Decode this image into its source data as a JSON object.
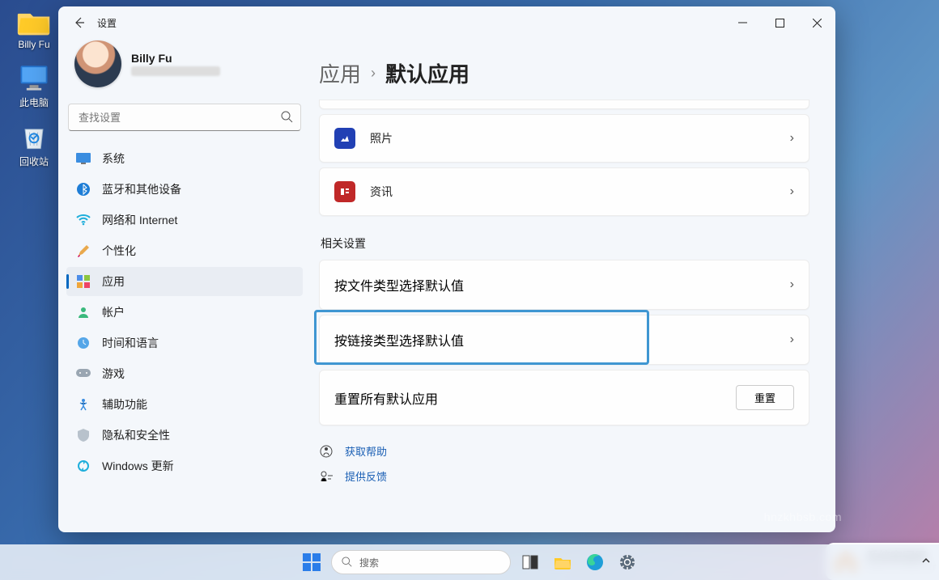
{
  "desktop": {
    "icons": [
      {
        "name": "billy-fu-folder",
        "label": "Billy Fu"
      },
      {
        "name": "this-pc",
        "label": "此电脑"
      },
      {
        "name": "recycle-bin",
        "label": "回收站"
      }
    ]
  },
  "settings_window": {
    "title": "设置",
    "profile": {
      "name": "Billy Fu"
    },
    "search": {
      "placeholder": "查找设置"
    },
    "nav": [
      {
        "id": "system",
        "label": "系统"
      },
      {
        "id": "bluetooth",
        "label": "蓝牙和其他设备"
      },
      {
        "id": "network",
        "label": "网络和 Internet"
      },
      {
        "id": "personalization",
        "label": "个性化"
      },
      {
        "id": "apps",
        "label": "应用",
        "active": true
      },
      {
        "id": "accounts",
        "label": "帐户"
      },
      {
        "id": "time",
        "label": "时间和语言"
      },
      {
        "id": "gaming",
        "label": "游戏"
      },
      {
        "id": "accessibility",
        "label": "辅助功能"
      },
      {
        "id": "privacy",
        "label": "隐私和安全性"
      },
      {
        "id": "update",
        "label": "Windows 更新"
      }
    ],
    "breadcrumb": {
      "parent": "应用",
      "current": "默认应用"
    },
    "app_cards": [
      {
        "id": "photos",
        "label": "照片",
        "icon_bg": "#2140b4"
      },
      {
        "id": "news",
        "label": "资讯",
        "icon_bg": "#c02828"
      }
    ],
    "related_title": "相关设置",
    "related": [
      {
        "id": "by-file-type",
        "label": "按文件类型选择默认值"
      },
      {
        "id": "by-link-type",
        "label": "按链接类型选择默认值",
        "highlighted": true
      }
    ],
    "reset_row": {
      "label": "重置所有默认应用",
      "button": "重置"
    },
    "footer_links": [
      {
        "id": "get-help",
        "label": "获取帮助"
      },
      {
        "id": "give-feedback",
        "label": "提供反馈"
      }
    ]
  },
  "taskbar": {
    "search_placeholder": "搜索"
  },
  "watermark": "hnzkhbsb.com",
  "badge": {
    "title": "系统家园网",
    "sub": "WWW.XTHOME.NET"
  }
}
